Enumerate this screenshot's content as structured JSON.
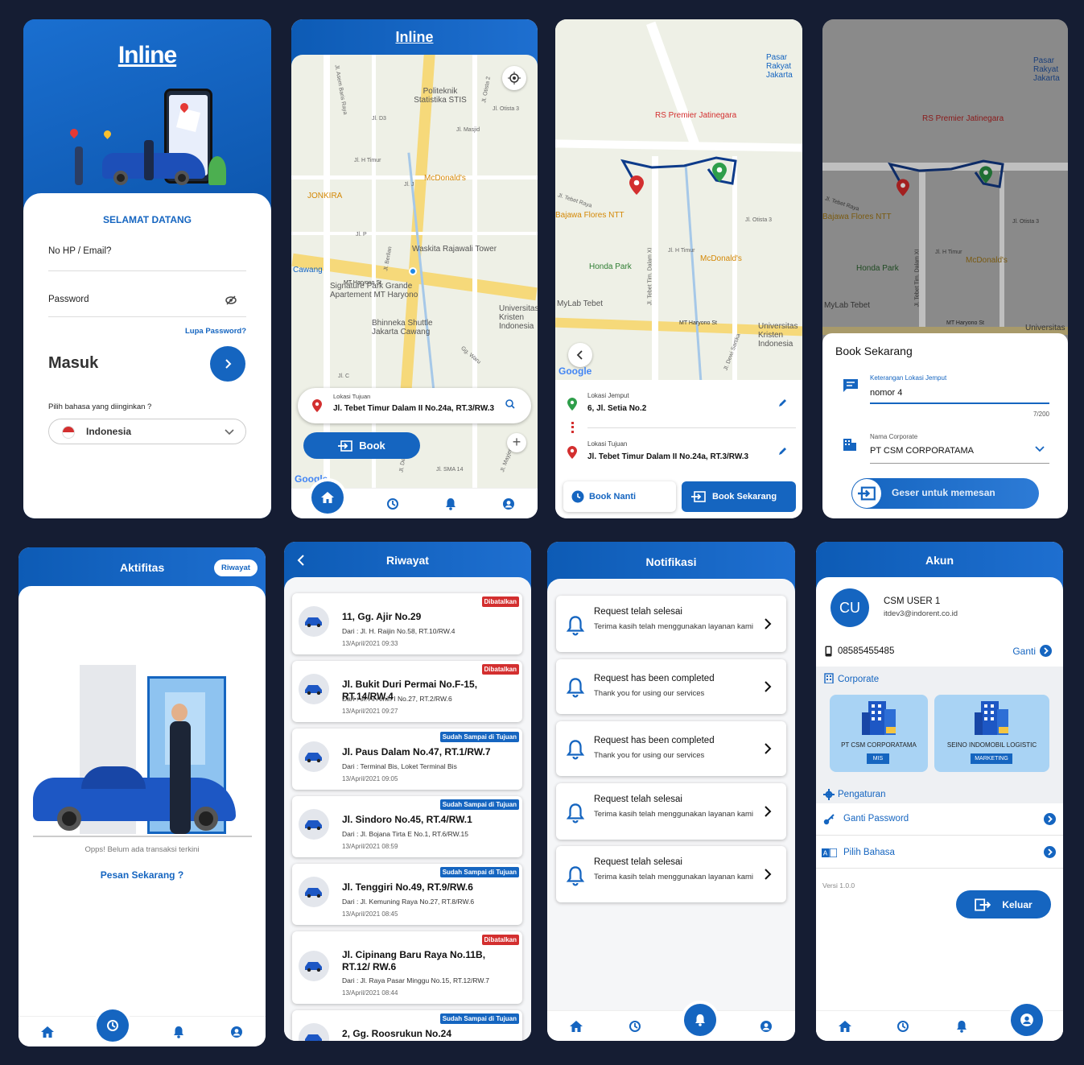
{
  "login": {
    "logo": "Inline",
    "welcome": "SELAMAT DATANG",
    "phone_label": "No HP / Email?",
    "password_label": "Password",
    "forgot": "Lupa Password?",
    "masuk": "Masuk",
    "lang_prompt": "Pilih bahasa yang diinginkan ?",
    "lang_value": "Indonesia"
  },
  "home": {
    "logo": "Inline",
    "places": [
      "Politeknik Statistika STIS",
      "McDonald's",
      "JONKIRA",
      "Waskita Rajawali Tower",
      "Signature Park Grande Apartement MT Haryono",
      "Bhinneka Shuttle Jakarta Cawang",
      "Universitas Kristen Indonesia",
      "Cawang"
    ],
    "streets": [
      "Jl. Asem Baris Raya",
      "Jl. Otista 2",
      "Jl. Otista 3",
      "Jl. D3",
      "Jl. Masjid",
      "Jl. H Timur",
      "Jl. J",
      "Jl. P",
      "Jl. Berlian",
      "MT Haryono St",
      "Gg. Waru",
      "Jl. C",
      "Jl. Dewi S",
      "Jl. SMA 14",
      "Jl. Mayjen"
    ],
    "dest_label": "Lokasi Tujuan",
    "dest_value": "Jl. Tebet Timur Dalam II No.24a,   RT.3/RW.3",
    "book": "Book",
    "google": "Google"
  },
  "route": {
    "places": [
      "Pasar Rakyat Jakarta",
      "RS Premier Jatinegara",
      "Bajawa Flores NTT",
      "McDonald's",
      "Honda Park",
      "MyLab Tebet",
      "Universitas Kristen Indonesia"
    ],
    "streets": [
      "Jl. Tebet Raya",
      "Jl. Otista 3",
      "Jl. H Timur",
      "Jl. Tebet Tim. Dalam XI",
      "MT Haryono St",
      "Jl. Dewi Sartika"
    ],
    "pickup_label": "Lokasi Jemput",
    "pickup_value": "6,   Jl. Setia No.2",
    "dest_label": "Lokasi Tujuan",
    "dest_value": "Jl. Tebet Timur Dalam II No.24a,   RT.3/RW.3",
    "book_later": "Book Nanti",
    "book_now": "Book Sekarang",
    "google": "Google"
  },
  "booking": {
    "places": [
      "Pasar Rakyat Jakarta",
      "RS Premier Jatinegara",
      "Bajawa Flores NTT",
      "McDonald's",
      "Honda Park",
      "MyLab Tebet",
      "Universitas"
    ],
    "streets": [
      "Jl. Tebet Raya",
      "Jl. Otista 3",
      "Jl. H Timur",
      "Jl. Tebet Tim. Dalam XI",
      "MT Haryono St"
    ],
    "title": "Book Sekarang",
    "note_label": "Keterangan Lokasi Jemput",
    "note_value": "nomor 4",
    "counter": "7/200",
    "corp_label": "Nama Corporate",
    "corp_value": "PT CSM CORPORATAMA",
    "swipe": "Geser untuk memesan"
  },
  "activity": {
    "title": "Aktifitas",
    "history_btn": "Riwayat",
    "empty": "Opps! Belum ada transaksi terkini",
    "order": "Pesan Sekarang ?"
  },
  "history": {
    "title": "Riwayat",
    "items": [
      {
        "title": "11,   Gg. Ajir No.29",
        "from": "Dari : Jl. H. Raijin No.58,   RT.10/RW.4",
        "date": "13/April/2021 09:33",
        "status": "Dibatalkan"
      },
      {
        "title": "Jl. Bukit Duri Permai No.F-15,   RT.14/RW.4",
        "from": "Dari : Jl. Al Amin I No.27,   RT.2/RW.6",
        "date": "13/April/2021 09:27",
        "status": "Dibatalkan"
      },
      {
        "title": "Jl. Paus Dalam No.47,   RT.1/RW.7",
        "from": "Dari : Terminal Bis,   Loket Terminal Bis",
        "date": "13/April/2021 09:05",
        "status": "Sudah Sampai di Tujuan"
      },
      {
        "title": "Jl. Sindoro No.45,   RT.4/RW.1",
        "from": "Dari : Jl. Bojana Tirta E No.1,   RT.6/RW.15",
        "date": "13/April/2021 08:59",
        "status": "Sudah Sampai di Tujuan"
      },
      {
        "title": "Jl. Tenggiri No.49,   RT.9/RW.6",
        "from": "Dari : Jl. Kemuning Raya No.27,   RT.8/RW.6",
        "date": "13/April/2021 08:45",
        "status": "Sudah Sampai di Tujuan"
      },
      {
        "title": "Jl. Cipinang Baru Raya No.11B,   RT.12/ RW.6",
        "from": "Dari : Jl. Raya Pasar Minggu No.15,   RT.12/RW.7",
        "date": "13/April/2021 08:44",
        "status": "Dibatalkan"
      },
      {
        "title": "2,   Gg. Roosrukun No.24",
        "from": "",
        "date": "",
        "status": "Sudah Sampai di Tujuan"
      }
    ]
  },
  "notif": {
    "title": "Notifikasi",
    "items": [
      {
        "title": "Request telah selesai",
        "body": "Terima kasih telah menggunakan layanan kami"
      },
      {
        "title": "Request has been completed",
        "body": "Thank you for using our services"
      },
      {
        "title": "Request has been completed",
        "body": "Thank you for using our services"
      },
      {
        "title": "Request telah selesai",
        "body": "Terima kasih telah menggunakan layanan kami"
      },
      {
        "title": "Request telah selesai",
        "body": "Terima kasih telah menggunakan layanan kami"
      }
    ]
  },
  "account": {
    "title": "Akun",
    "initials": "CU",
    "name": "CSM USER 1",
    "email": "itdev3@indorent.co.id",
    "phone": "08585455485",
    "change": "Ganti",
    "corporate": "Corporate",
    "corps": [
      {
        "name": "PT CSM CORPORATAMA",
        "tag": "MIS"
      },
      {
        "name": "SEINO INDOMOBIL LOGISTIC",
        "tag": "MARKETING"
      }
    ],
    "settings": "Pengaturan",
    "change_pw": "Ganti Password",
    "choose_lang": "Pilih Bahasa",
    "version": "Versi 1.0.0",
    "logout": "Keluar"
  },
  "colors": {
    "primary": "#1565c0",
    "danger": "#d32f2f",
    "background": "#151d33"
  }
}
